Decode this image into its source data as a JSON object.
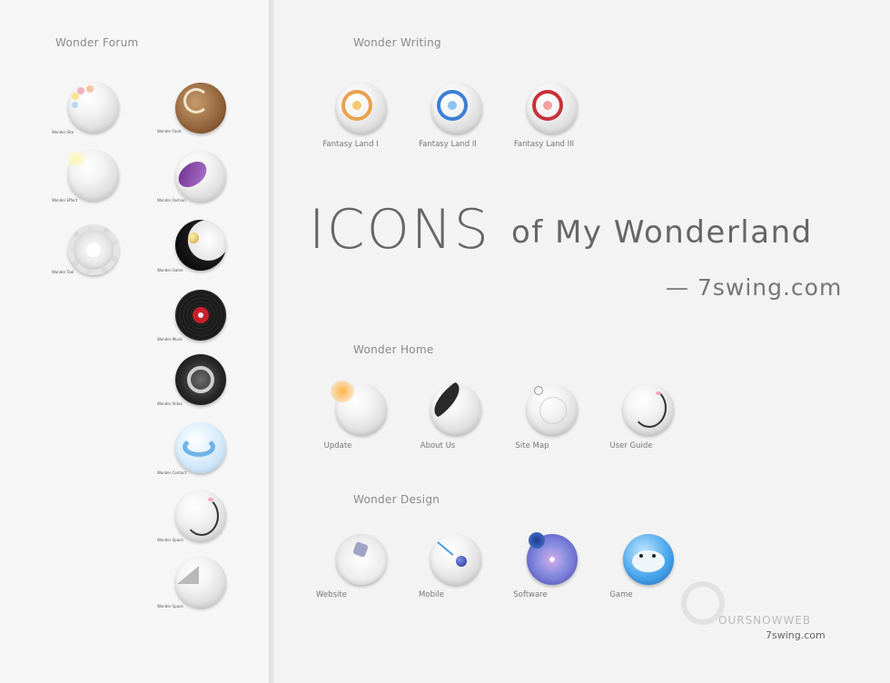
{
  "left_panel": {
    "title": "Wonder Forum",
    "col1": [
      {
        "label": "Wonder Site",
        "icon": "pastel-dots-sphere-icon"
      },
      {
        "label": "Wonder Effect",
        "icon": "light-flare-sphere-icon"
      },
      {
        "label": "Wonder Tool",
        "icon": "gear-icon"
      }
    ],
    "col2": [
      {
        "label": "Wonder Food",
        "icon": "swirl-bread-icon"
      },
      {
        "label": "Wonder Fashion",
        "icon": "purple-fabric-sphere-icon"
      },
      {
        "label": "Wonder Game",
        "icon": "yin-yang-ball-icon"
      },
      {
        "label": "Wonder Music",
        "icon": "vinyl-record-icon"
      },
      {
        "label": "Wonder Video",
        "icon": "camera-lens-icon"
      },
      {
        "label": "Wonder Contact",
        "icon": "blue-swirl-bubble-icon"
      },
      {
        "label": "Wonder Space",
        "icon": "doodle-face-sphere-icon"
      },
      {
        "label": "Wonder Space",
        "icon": "cone-sphere-icon"
      }
    ]
  },
  "writing": {
    "title": "Wonder Writing",
    "items": [
      {
        "label": "Fantasy Land I",
        "icon": "orange-compass-orb-icon"
      },
      {
        "label": "Fantasy Land II",
        "icon": "blue-compass-orb-icon"
      },
      {
        "label": "Fantasy Land III",
        "icon": "red-compass-orb-icon"
      }
    ]
  },
  "hero": {
    "title": "ICONS",
    "subtitle": "of My Wonderland",
    "site": "— 7swing.com"
  },
  "home": {
    "title": "Wonder Home",
    "items": [
      {
        "label": "Update",
        "icon": "glow-sphere-icon"
      },
      {
        "label": "About Us",
        "icon": "pen-nib-icon"
      },
      {
        "label": "Site Map",
        "icon": "radar-sphere-icon"
      },
      {
        "label": "User Guide",
        "icon": "doodle-sphere-icon"
      }
    ]
  },
  "design": {
    "title": "Wonder Design",
    "items": [
      {
        "label": "Website",
        "icon": "glass-sphere-icon"
      },
      {
        "label": "Mobile",
        "icon": "stylus-sphere-icon"
      },
      {
        "label": "Software",
        "icon": "cd-disc-icon"
      },
      {
        "label": "Game",
        "icon": "blue-fish-icon"
      }
    ]
  },
  "watermark": {
    "brand": "OURSNOWWEB",
    "site": "7swing.com"
  }
}
